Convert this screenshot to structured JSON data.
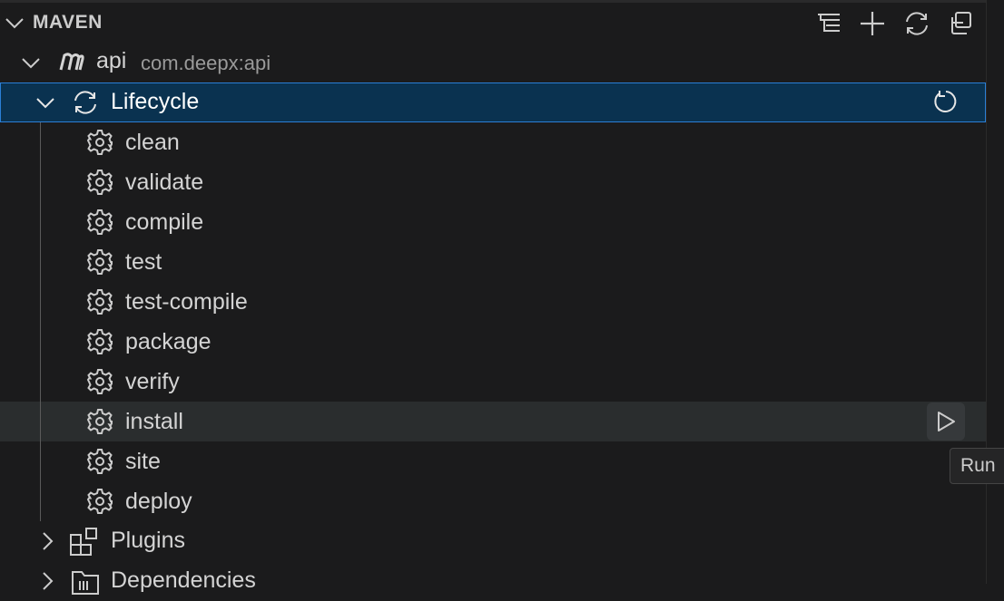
{
  "header": {
    "title": "MAVEN"
  },
  "project": {
    "name": "api",
    "artifact": "com.deepx:api"
  },
  "lifecycle": {
    "label": "Lifecycle"
  },
  "goals": [
    "clean",
    "validate",
    "compile",
    "test",
    "test-compile",
    "package",
    "verify",
    "install",
    "site",
    "deploy"
  ],
  "plugins": {
    "label": "Plugins"
  },
  "dependencies": {
    "label": "Dependencies"
  },
  "tooltip": {
    "text": "Run"
  }
}
